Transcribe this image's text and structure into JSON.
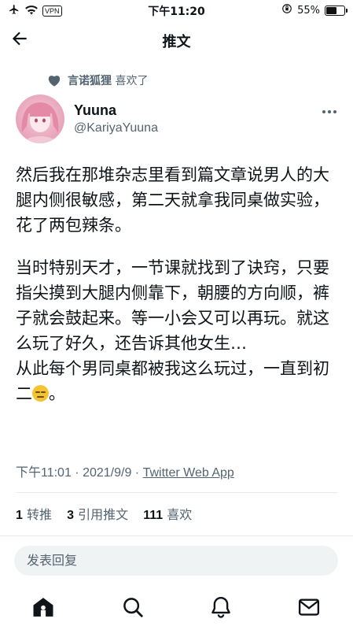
{
  "status_bar": {
    "network": "VPN",
    "time": "下午11:20",
    "battery_text": "55%",
    "battery_level": 0.55
  },
  "nav": {
    "title": "推文"
  },
  "liked_by": {
    "name": "言诺狐狸",
    "action": "喜欢了"
  },
  "author": {
    "display_name": "Yuuna",
    "handle": "@KariyaYuuna"
  },
  "tweet": {
    "paragraph1": "然后我在那堆杂志里看到篇文章说男人的大腿内侧很敏感，第二天就拿我同桌做实验，花了两包辣条。",
    "paragraph2": "当时特别天才，一节课就找到了诀窍，只要指尖摸到大腿内侧靠下，朝腰的方向顺，裤子就会鼓起来。等一小会又可以再玩。就这么玩了好久，还告诉其他女生…",
    "paragraph3_before_emoji": "从此每个男同桌都被我这么玩过，一直到初二",
    "paragraph3_after_emoji": "。",
    "emoji": "expressionless-face"
  },
  "meta": {
    "time": "下午11:01",
    "sep1": " · ",
    "date": "2021/9/9",
    "sep2": " · ",
    "source": "Twitter Web App"
  },
  "stats": {
    "retweets_count": "1",
    "retweets_label": "转推",
    "quotes_count": "3",
    "quotes_label": "引用推文",
    "likes_count": "111",
    "likes_label": "喜欢"
  },
  "reply": {
    "placeholder": "发表回复"
  },
  "tabbar": {
    "icons": [
      "home-icon",
      "search-icon",
      "notifications-icon",
      "messages-icon"
    ]
  },
  "colors": {
    "text": "#0f1419",
    "secondary": "#536471",
    "divider": "#e6ecf0",
    "reply_bg": "#eff3f4"
  }
}
